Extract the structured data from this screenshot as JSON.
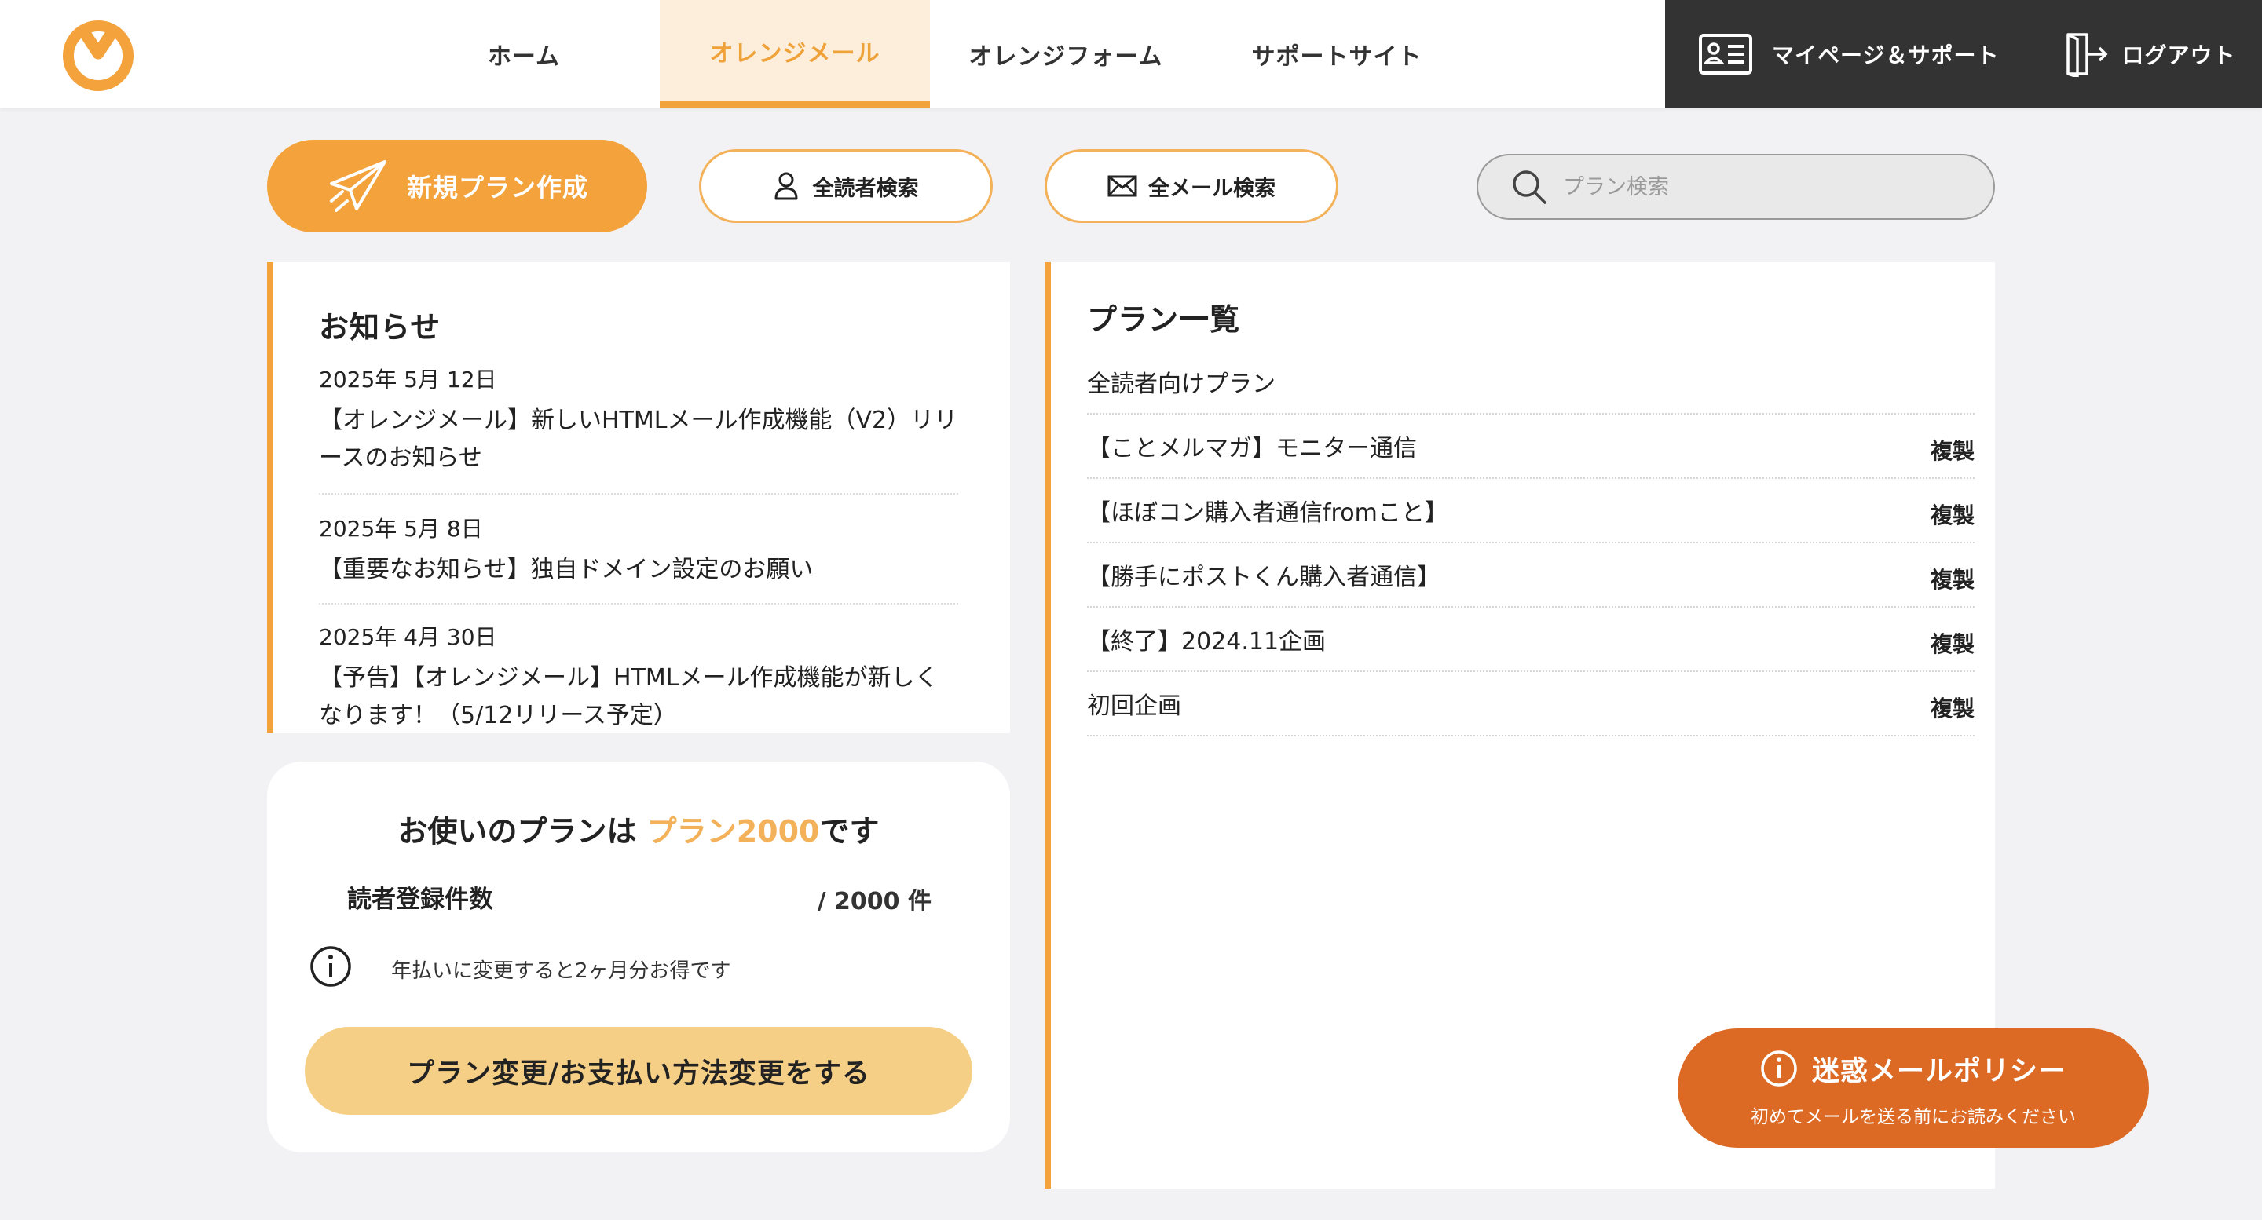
{
  "header": {
    "nav": [
      {
        "label": "ホーム",
        "active": false
      },
      {
        "label": "オレンジメール",
        "active": true
      },
      {
        "label": "オレンジフォーム",
        "active": false
      },
      {
        "label": "サポートサイト",
        "active": false
      }
    ],
    "mypage_label": "マイページ＆サポート",
    "logout_label": "ログアウト"
  },
  "toolbar": {
    "new_plan_label": "新規プラン作成",
    "reader_search_label": "全読者検索",
    "mail_search_label": "全メール検索",
    "plan_search_placeholder": "プラン検索"
  },
  "news": {
    "title": "お知らせ",
    "items": [
      {
        "date": "2025年 5月 12日",
        "text": "【オレンジメール】新しいHTMLメール作成機能（V2）リリースのお知らせ"
      },
      {
        "date": "2025年 5月 8日",
        "text": "【重要なお知らせ】独自ドメイン設定のお願い"
      },
      {
        "date": "2025年 4月 30日",
        "text": "【予告】【オレンジメール】HTMLメール作成機能が新しくなります！（5/12リリース予定）"
      }
    ]
  },
  "plan_info": {
    "headline_prefix": "お使いのプランは ",
    "plan_name": "プラン2000",
    "headline_suffix": "です",
    "reader_label": "読者登録件数",
    "reader_limit": "/ 2000 件",
    "notice": "年払いに変更すると2ヶ月分お得です",
    "change_button": "プラン変更/お支払い方法変更をする"
  },
  "plans": {
    "title": "プラン一覧",
    "section_label": "全読者向けプラン",
    "rows": [
      {
        "name": "【ことメルマガ】モニター通信",
        "action": "複製"
      },
      {
        "name": "【ほぼコン購入者通信fromこと】",
        "action": "複製"
      },
      {
        "name": "【勝手にポストくん購入者通信】",
        "action": "複製"
      },
      {
        "name": "【終了】2024.11企画",
        "action": "複製"
      },
      {
        "name": "初回企画",
        "action": "複製"
      }
    ]
  },
  "policy": {
    "title": "迷惑メールポリシー",
    "subtitle": "初めてメールを送る前にお読みください"
  },
  "colors": {
    "accent": "#f3a23c",
    "accent_light": "#f6cf86",
    "policy": "#dc6a25",
    "dark": "#333333"
  }
}
